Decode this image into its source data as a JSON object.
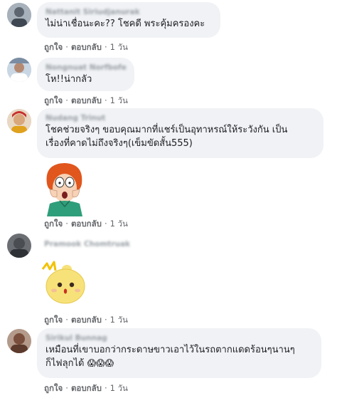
{
  "actions": {
    "like": "ถูกใจ",
    "reply": "ตอบกลับ",
    "separator": "·",
    "time": "1 วัน"
  },
  "comments": [
    {
      "name": "Nattanit Siriudjanurak",
      "text_lines": [
        "ไม่น่าเชื่อนะคะ?? โชคดี พระคุ้มครองคะ"
      ]
    },
    {
      "name": "Nongnuat Norfbofe",
      "text_lines": [
        "โห!!น่ากลัว"
      ]
    },
    {
      "name": "Nudang Trinut",
      "text_lines": [
        "โชคช่วยจริงๆ ขอบคุณมากที่แชร์เป็นอุทาหรณ์ให้ระวังกัน เป็น",
        "เรื่องที่คาดไม่ถึงจริงๆ(เข็มขัดสั้น555)"
      ]
    },
    {
      "name": "Pramook Chomtruak",
      "text_lines": []
    },
    {
      "name": "Sirikul Bunnag",
      "text_lines": [
        "เหมือนที่เขาบอกว่ากระดาษขาวเอาไว้ในรถตากแดดร้อนๆนานๆ",
        "ก็ไฟลุกได้"
      ],
      "emoji": "😱😱😱"
    }
  ],
  "colors": {
    "bubble": "#f0f2f5",
    "meta": "#65676b",
    "text": "#1c1e21"
  }
}
